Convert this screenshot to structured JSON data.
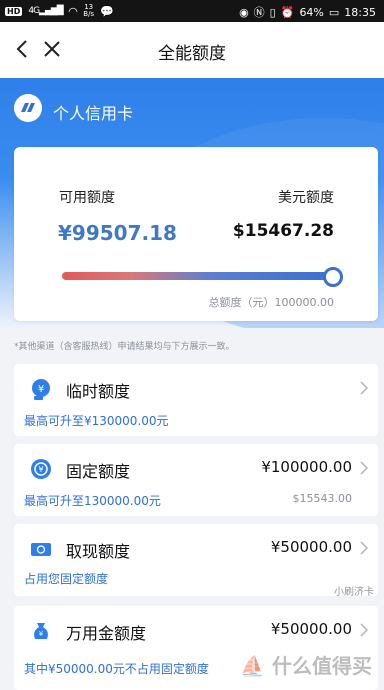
{
  "status": {
    "hd": "HD",
    "network": "4G",
    "speed_value": "13",
    "speed_unit": "B/s",
    "battery": "64%",
    "time": "18:35"
  },
  "nav": {
    "title": "全能额度"
  },
  "card": {
    "name": "个人信用卡"
  },
  "summary": {
    "available_label": "可用额度",
    "available_value": "¥99507.18",
    "usd_label": "美元额度",
    "usd_value": "$15467.28",
    "total_text": "总额度（元）100000.00",
    "available_fraction": 0.995
  },
  "note": "*其他渠道（含客服热线）申请结果均与下方展示一致。",
  "items": [
    {
      "name": "临时额度",
      "amount": "",
      "sub": "最高可升至¥130000.00元",
      "sub_right": ""
    },
    {
      "name": "固定额度",
      "amount": "¥100000.00",
      "sub": "最高可升至130000.00元",
      "sub_right": "$15543.00"
    },
    {
      "name": "取现额度",
      "amount": "¥50000.00",
      "sub": "占用您固定额度",
      "sub_right": ""
    },
    {
      "name": "万用金额度",
      "amount": "¥50000.00",
      "sub": "其中¥50000.00元不占用固定额度",
      "sub_right": ""
    }
  ],
  "watermark": {
    "top": "小刷济卡",
    "brand": "什么值得买"
  },
  "colors": {
    "accent": "#3e78c8",
    "hero": "#2f7fe9",
    "link": "#2f6fd8"
  }
}
